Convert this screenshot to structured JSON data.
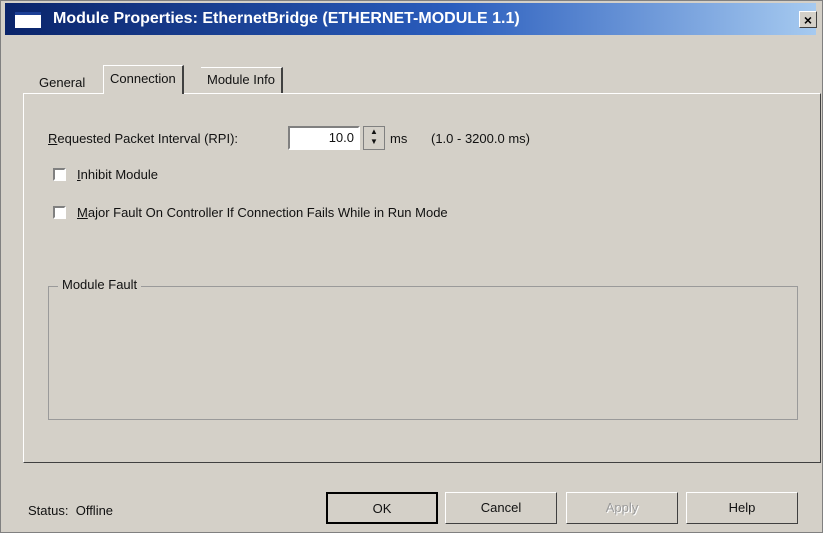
{
  "window": {
    "title": "Module Properties: EthernetBridge (ETHERNET-MODULE 1.1)"
  },
  "tabs": [
    "General",
    "Connection",
    "Module Info"
  ],
  "connection": {
    "rpi_label": "Requested Packet Interval (RPI):",
    "rpi_value": "10.0",
    "rpi_unit": "ms",
    "rpi_range": "(1.0 - 3200.0 ms)",
    "inhibit_label": "Inhibit Module",
    "inhibit_checked": false,
    "major_fault_label": "Major Fault On Controller If Connection Fails While in Run Mode",
    "major_fault_checked": false,
    "module_fault_title": "Module Fault"
  },
  "status": {
    "label": "Status:",
    "value": "Offline"
  },
  "buttons": {
    "ok": "OK",
    "cancel": "Cancel",
    "apply": "Apply",
    "help": "Help"
  }
}
